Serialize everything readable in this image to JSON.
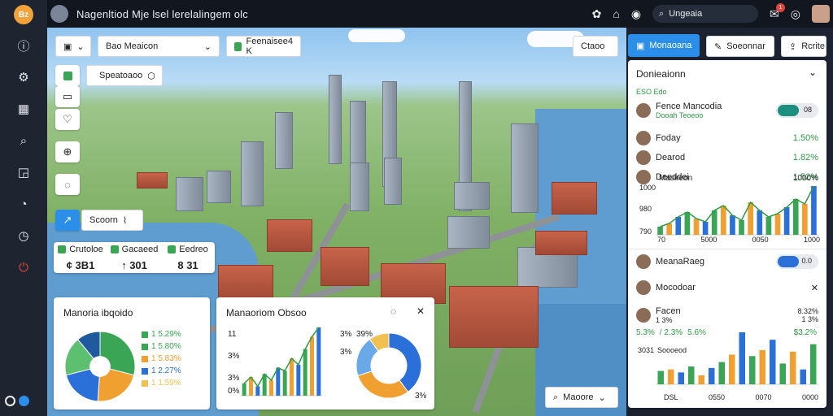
{
  "sidebar": {
    "logo": "Bz",
    "items": [
      {
        "icon": "info-icon",
        "glyph": "ⓘ"
      },
      {
        "icon": "gear-icon",
        "glyph": "⚙"
      },
      {
        "icon": "calendar-icon",
        "glyph": "▦"
      },
      {
        "icon": "search-icon",
        "glyph": "⌕"
      },
      {
        "icon": "chart-icon",
        "glyph": "◲"
      },
      {
        "icon": "chat-icon",
        "glyph": "◔"
      },
      {
        "icon": "clock-icon",
        "glyph": "◷"
      },
      {
        "icon": "power-icon",
        "glyph": "⏻"
      }
    ]
  },
  "topbar": {
    "title": "Nagenltiod Mje lsel lerelalingem olc",
    "search_value": "Ungeaia",
    "notif_count": "1"
  },
  "toolbar": {
    "view_select": "Bao Meaicon",
    "tag_btn": "Feenaisee4 K",
    "sub_btn": "Speatoaoo",
    "share_btn": "Scoorn"
  },
  "right_btns": {
    "b1": "Ctaoo",
    "b2": "Monaoana",
    "b3": "Soeonnar",
    "b4": "Rcrite"
  },
  "stats": [
    {
      "label": "Crutoloe",
      "value": "3B1"
    },
    {
      "label": "Gacaeed",
      "value": "301"
    },
    {
      "label": "Eedreo",
      "value": "31"
    }
  ],
  "stat_prefix": [
    "¢",
    "↑",
    "8"
  ],
  "panel_left": {
    "title": "Manoria ibqoido",
    "legend": [
      {
        "label": "1 5.29%",
        "color": "#3aa655"
      },
      {
        "label": "1 5.80%",
        "color": "#3aa655"
      },
      {
        "label": "1 5.83%",
        "color": "#f0a030"
      },
      {
        "label": "1 2.27%",
        "color": "#2b6fd8"
      },
      {
        "label": "1 1.59%",
        "color": "#f0c050"
      }
    ]
  },
  "panel_mid": {
    "title": "Manaoriom Obsoo",
    "y_ticks": [
      "11",
      "3%",
      "3%",
      "0%"
    ],
    "x_tick": "0s",
    "donut_labels": [
      "3%",
      "39%",
      "3%",
      "3%"
    ]
  },
  "rightpanel": {
    "title": "Donieaionn",
    "subtitle": "ESO Edo",
    "person1_name": "Fence Mancodia",
    "person1_sub": "Dooah Teoeoo",
    "person1_toggle": "08",
    "list": [
      {
        "name": "Foday",
        "value": "1.50%"
      },
      {
        "name": "Dearod",
        "value": "1.82%"
      },
      {
        "name": "Deeddei",
        "value": "1.52%"
      }
    ],
    "chart_label_left": "Masireon",
    "chart_label_right": "1000%",
    "y_ticks": [
      "1000",
      "980",
      "790"
    ],
    "x_ticks": [
      "70",
      "5000",
      "0050",
      "1000"
    ],
    "person2_name": "MeanaRaeg",
    "person2_toggle": "0.0",
    "person3_name": "Mocodoar",
    "person4_name": "Facen",
    "person4_sub": "1 3%",
    "person4_pct": "8.32%",
    "person4_pct2": "1 3%",
    "pct_row": [
      "5.3%",
      "/ 2.3%",
      "5.6%"
    ],
    "pct_right": "$3.2%",
    "chart2_label": "Soooeod",
    "chart2_y": "3031",
    "x_ticks2": [
      "DSL",
      "0550",
      "0070",
      "0000"
    ],
    "bottom_btn": "Maoore"
  },
  "chart_data": [
    {
      "type": "pie",
      "values": [
        29,
        22,
        20,
        18,
        11
      ],
      "colors": [
        "#3aa655",
        "#f0a030",
        "#2b6fd8",
        "#5cc070",
        "#1f5a9e"
      ],
      "labels": [
        "1 5.29%",
        "1 5.80%",
        "1 5.83%",
        "1 2.27%",
        "1 1.59%"
      ]
    },
    {
      "type": "bar",
      "categories": [
        "a",
        "b",
        "c",
        "d",
        "e",
        "f",
        "g",
        "h",
        "i",
        "j",
        "k",
        "l"
      ],
      "series": [
        {
          "values": [
            8,
            12,
            6,
            14,
            10,
            18,
            16,
            24,
            20,
            30,
            38,
            44
          ],
          "colors": [
            "#3aa655",
            "#f0a030",
            "#2b6fd8"
          ]
        }
      ]
    },
    {
      "type": "pie",
      "values": [
        40,
        30,
        20,
        10
      ],
      "colors": [
        "#2b6fd8",
        "#f0a030",
        "#6aa9e8",
        "#f0c050"
      ]
    },
    {
      "type": "bar",
      "categories": [
        "1",
        "2",
        "3",
        "4",
        "5",
        "6",
        "7",
        "8",
        "9",
        "10",
        "11",
        "12",
        "13",
        "14",
        "15",
        "16",
        "17",
        "18"
      ],
      "series": [
        {
          "values": [
            10,
            14,
            22,
            28,
            20,
            16,
            30,
            36,
            24,
            18,
            40,
            30,
            22,
            26,
            34,
            44,
            38,
            60
          ],
          "colors": [
            "#3aa655",
            "#f0a030",
            "#2b6fd8",
            "#3aa655",
            "#f0a030",
            "#2b6fd8"
          ]
        }
      ]
    },
    {
      "type": "bar",
      "categories": [
        "1",
        "2",
        "3",
        "4",
        "5",
        "6",
        "7",
        "8",
        "9",
        "10",
        "11",
        "12",
        "13",
        "14",
        "15",
        "16"
      ],
      "series": [
        {
          "values": [
            18,
            20,
            16,
            24,
            12,
            22,
            30,
            40,
            70,
            38,
            46,
            60,
            28,
            44,
            20,
            54
          ],
          "colors": [
            "#3aa655",
            "#f0a030",
            "#2b6fd8",
            "#3aa655",
            "#f0a030",
            "#2b6fd8"
          ]
        }
      ]
    }
  ]
}
